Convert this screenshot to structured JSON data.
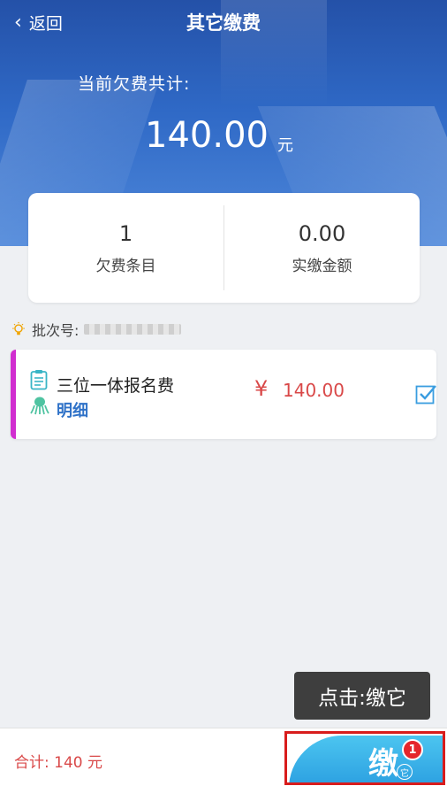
{
  "nav": {
    "back_label": "返回",
    "title": "其它缴费"
  },
  "summary": {
    "label": "当前欠费共计:",
    "amount": "140.00",
    "unit": "元"
  },
  "stats": [
    {
      "value": "1",
      "label": "欠费条目"
    },
    {
      "value": "0.00",
      "label": "实缴金额"
    }
  ],
  "batch": {
    "label": "批次号:"
  },
  "fee_item": {
    "name": "三位一体报名费",
    "detail_label": "明细",
    "currency": "¥",
    "price": "140.00",
    "checked": true,
    "accent_color": "#d12ed0"
  },
  "tooltip": {
    "text": "点击:缴它"
  },
  "footer": {
    "total": "合计:  140 元",
    "pay_button": {
      "glyph": "缴",
      "sub_glyph": "它",
      "badge": "1"
    }
  },
  "colors": {
    "header_blue": "#2f69c6",
    "price_red": "#d94848",
    "link_blue": "#2f72c8",
    "highlight_red": "#d81c1c"
  }
}
